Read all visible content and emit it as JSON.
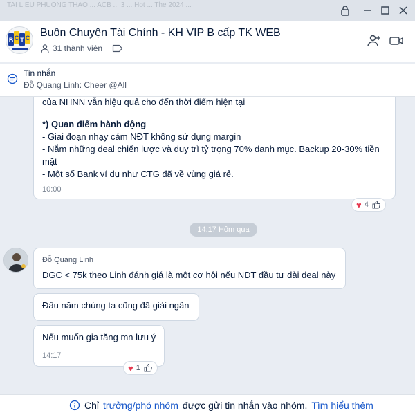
{
  "topbar": {
    "faint_tabs": "TAI LIEU PHUONG THAO ... ACB ... 3 ... Hot ... The 2024 ..."
  },
  "header": {
    "group_name": "Buôn Chuyện Tài Chính - KH VIP B cấp TK WEB",
    "member_count": "31 thành viên",
    "avatar_text": "BCTC"
  },
  "pinned": {
    "title": "Tin nhắn",
    "text": "Đỗ Quang Linh: Cheer @All"
  },
  "messages": {
    "first": {
      "cut_line": "của NHNN vẫn hiệu quả cho đến thời điểm hiện tại",
      "heading": "*) Quan điểm hành động",
      "lines": [
        "- Giai đoạn nhạy cảm NĐT không sử dụng margin",
        "- Nắm những deal chiến lược và duy trì tỷ trọng 70% danh mục. Backup 20-30% tiền",
        "mặt",
        "- Một số Bank ví dụ như CTG đã về vùng giá rẻ."
      ],
      "time": "10:00",
      "reaction_count": "4"
    },
    "date_separator": "14:17 Hôm qua",
    "sender": "Đỗ Quang Linh",
    "second": "DGC < 75k theo Linh đánh giá là một cơ hội nếu NĐT đầu tư dài deal này",
    "third": "Đầu năm chúng ta cũng đã giải ngân",
    "fourth": "Nếu muốn gia tăng mn lưu ý",
    "fourth_time": "14:17",
    "fourth_reaction_count": "1"
  },
  "footer": {
    "prefix": "Chỉ",
    "link1": "trưởng/phó nhóm",
    "middle": "được gửi tin nhắn vào nhóm.",
    "link2": "Tìm hiểu thêm"
  },
  "colors": {
    "accent": "#1656c9",
    "heart": "#e53950",
    "background": "#e9edf3"
  }
}
